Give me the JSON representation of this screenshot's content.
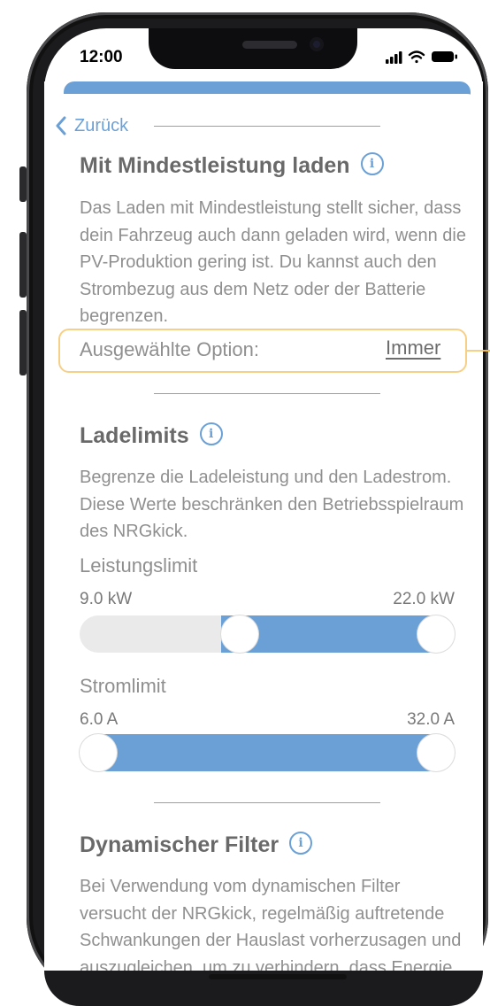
{
  "status_bar": {
    "time": "12:00"
  },
  "nav": {
    "back_label": "Zurück"
  },
  "min_power": {
    "title": "Mit Mindestleistung laden",
    "description": "Das Laden mit Mindestleistung stellt sicher, dass dein Fahrzeug auch dann geladen wird, wenn die PV-Produktion gering ist. Du kannst auch den Strombezug aus dem Netz oder der Batterie begrenzen.",
    "option_label": "Ausgewählte Option:",
    "option_value": "Immer"
  },
  "charge_limits": {
    "title": "Ladelimits",
    "description": "Begrenze die Ladeleistung und den Ladestrom. Diese Werte beschränken den Betriebsspielraum des NRGkick.",
    "power": {
      "label": "Leistungslimit",
      "min_label": "9.0 kW",
      "max_label": "22.0 kW",
      "low_fraction": 0.42,
      "high_fraction": 1.0
    },
    "current": {
      "label": "Stromlimit",
      "min_label": "6.0 A",
      "max_label": "32.0 A",
      "low_fraction": 0.0,
      "high_fraction": 1.0
    }
  },
  "dynamic_filter": {
    "title": "Dynamischer Filter",
    "description": "Bei Verwendung vom dynamischen Filter versucht der NRGkick, regelmäßig auftretende Schwankungen der Hauslast vorherzusagen und auszugleichen, um zu verhindern, dass Energie aus dem Netz"
  },
  "colors": {
    "accent": "#1f70c1",
    "highlight": "#f3b84a"
  }
}
